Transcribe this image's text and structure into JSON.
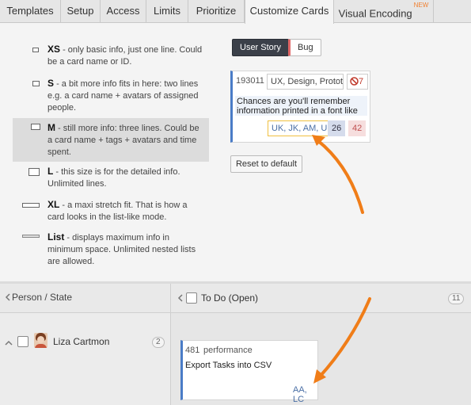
{
  "tabs": [
    {
      "label": "Templates"
    },
    {
      "label": "Setup"
    },
    {
      "label": "Access"
    },
    {
      "label": "Limits"
    },
    {
      "label": "Prioritize"
    },
    {
      "label": "Customize Cards",
      "active": true
    },
    {
      "label": "Visual Encoding",
      "badge": "NEW"
    }
  ],
  "sizes": [
    {
      "name": "XS",
      "desc": " - only basic info, just one line. Could be a card name or ID."
    },
    {
      "name": "S",
      "desc": " - a bit more info fits in here: two lines e.g. a card name + avatars of assigned people."
    },
    {
      "name": "M",
      "desc": " - still more info: three lines. Could be a card name + tags + avatars and time spent."
    },
    {
      "name": "L",
      "desc": " - this size is for the detailed info. Unlimited lines."
    },
    {
      "name": "XL",
      "desc": " - a maxi stretch fit. That is how a card looks in the list-like mode."
    },
    {
      "name": "List",
      "desc": " - displays maximum info in minimum space. Unlimited nested lists are allowed."
    }
  ],
  "selected_size": "M",
  "card_types": {
    "user_story": "User Story",
    "bug": "Bug"
  },
  "preview_card": {
    "id": "193011",
    "tags": "UX, Design, Prototyping",
    "bugs_count": "7",
    "description": "Chances are you'll remember information printed in a font like",
    "assignees": "UK, JK, AM, UK",
    "effort": "26",
    "time": "42"
  },
  "reset_label": "Reset to default",
  "board": {
    "axis_label": "Person / State",
    "column": {
      "label": "To Do (Open)",
      "count": "11"
    },
    "row": {
      "person": "Liza Cartmon",
      "count": "2"
    },
    "card": {
      "id": "481",
      "tag": "performance",
      "title": "Export Tasks into CSV",
      "assignees": "AA, LC"
    }
  },
  "colors": {
    "accent": "#f07d18",
    "story_border": "#4a7cc7",
    "bug_border": "#e06666"
  },
  "icons": [
    "tab-new-badge",
    "no-entry-icon",
    "chevron-left-icon",
    "chevron-up-icon",
    "avatar",
    "arrow-annotation"
  ]
}
